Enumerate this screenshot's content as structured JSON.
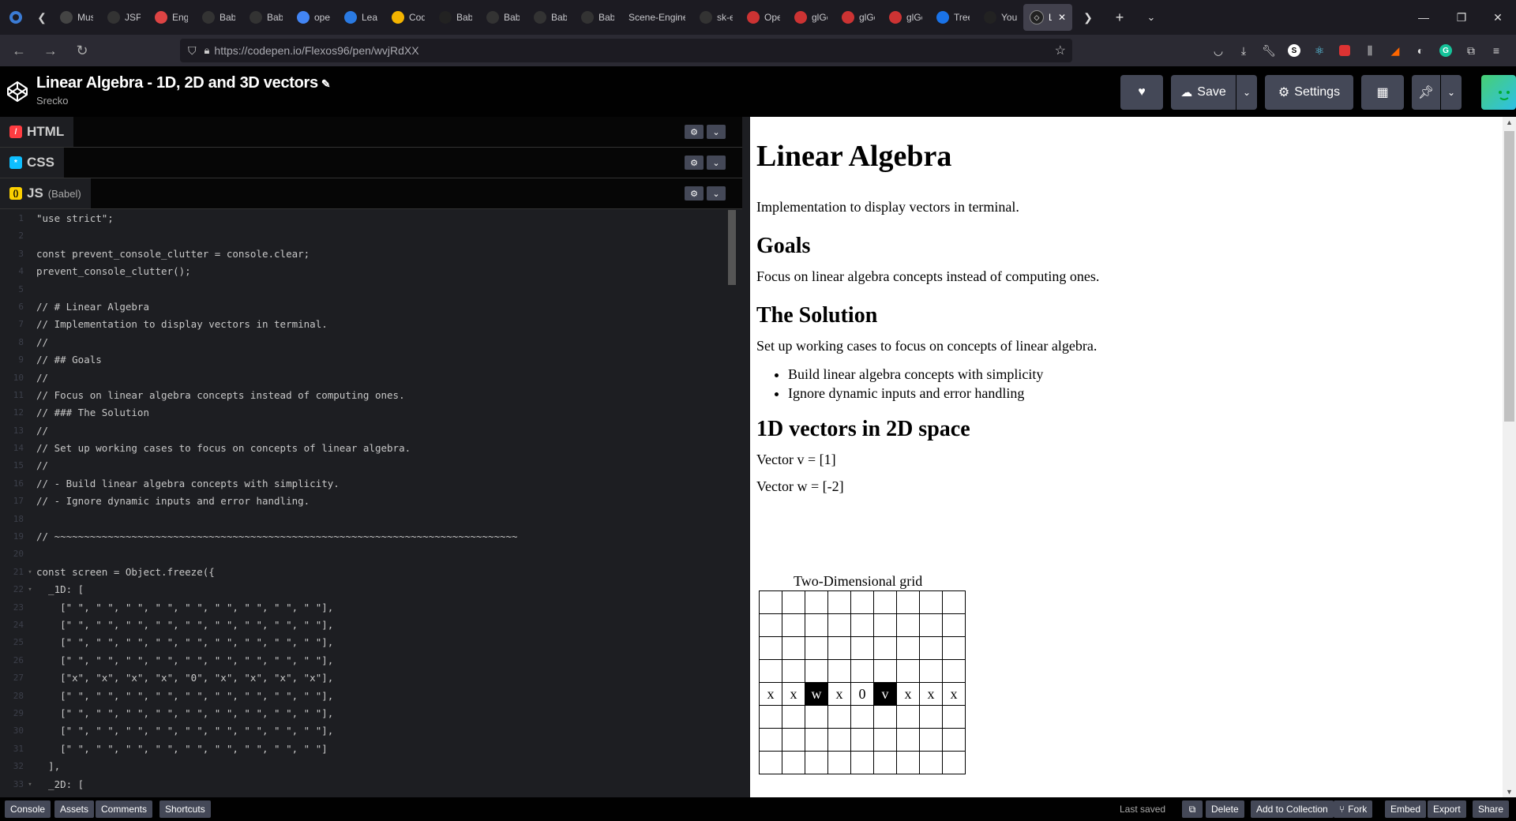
{
  "browser": {
    "tabs": [
      {
        "label": "Music",
        "icon": "music-icon",
        "color": "#444"
      },
      {
        "label": "JSProj",
        "icon": "github-icon",
        "color": "#333"
      },
      {
        "label": "Engine",
        "icon": "engine-icon",
        "color": "#d44"
      },
      {
        "label": "Babylon",
        "icon": "github-icon",
        "color": "#333"
      },
      {
        "label": "Babylon",
        "icon": "github-icon",
        "color": "#333"
      },
      {
        "label": "openg",
        "icon": "google-icon",
        "color": "#4285f4"
      },
      {
        "label": "Learn",
        "icon": "learn-icon",
        "color": "#2a7ae2"
      },
      {
        "label": "CodeP",
        "icon": "chart-icon",
        "color": "#f4b400"
      },
      {
        "label": "Babylon",
        "icon": "babylon-icon",
        "color": "#222"
      },
      {
        "label": "Babylon",
        "icon": "github-icon",
        "color": "#333"
      },
      {
        "label": "Babylon",
        "icon": "github-icon",
        "color": "#333"
      },
      {
        "label": "Babylon",
        "icon": "github-icon",
        "color": "#333"
      },
      {
        "label": "Scene-Engine",
        "icon": "none",
        "color": "#1c1b22"
      },
      {
        "label": "sk-eng",
        "icon": "github-icon",
        "color": "#333"
      },
      {
        "label": "OpenG",
        "icon": "opengl-icon",
        "color": "#c33"
      },
      {
        "label": "glGen",
        "icon": "opengl-icon",
        "color": "#c33"
      },
      {
        "label": "glGet",
        "icon": "opengl-icon",
        "color": "#c33"
      },
      {
        "label": "glGet",
        "icon": "opengl-icon",
        "color": "#c33"
      },
      {
        "label": "Tree G",
        "icon": "3d-icon",
        "color": "#1a73e8"
      },
      {
        "label": "Your W",
        "icon": "codepen-icon",
        "color": "#222"
      }
    ],
    "active_tab": "Linear",
    "url": "https://codepen.io/Flexos96/pen/wvjRdXX"
  },
  "pen": {
    "title": "Linear Algebra - 1D, 2D and 3D vectors",
    "author": "Srecko"
  },
  "header_buttons": {
    "save": "Save",
    "settings": "Settings"
  },
  "editors": {
    "html": "HTML",
    "css": "CSS",
    "js": "JS",
    "js_sub": "(Babel)"
  },
  "code_lines": [
    {
      "n": "1",
      "fold": "",
      "t": "\"use strict\";",
      "c": "str"
    },
    {
      "n": "2",
      "fold": "",
      "t": "",
      "c": ""
    },
    {
      "n": "3",
      "fold": "",
      "t": "const prevent_console_clutter = console.clear;",
      "c": "mix1"
    },
    {
      "n": "4",
      "fold": "",
      "t": "prevent_console_clutter();",
      "c": "def"
    },
    {
      "n": "5",
      "fold": "",
      "t": "",
      "c": ""
    },
    {
      "n": "6",
      "fold": "",
      "t": "// # Linear Algebra",
      "c": "com"
    },
    {
      "n": "7",
      "fold": "",
      "t": "// Implementation to display vectors in terminal.",
      "c": "com"
    },
    {
      "n": "8",
      "fold": "",
      "t": "//",
      "c": "com"
    },
    {
      "n": "9",
      "fold": "",
      "t": "// ## Goals",
      "c": "com"
    },
    {
      "n": "10",
      "fold": "",
      "t": "//",
      "c": "com"
    },
    {
      "n": "11",
      "fold": "",
      "t": "// Focus on linear algebra concepts instead of computing ones.",
      "c": "com"
    },
    {
      "n": "12",
      "fold": "",
      "t": "// ### The Solution",
      "c": "com"
    },
    {
      "n": "13",
      "fold": "",
      "t": "//",
      "c": "com"
    },
    {
      "n": "14",
      "fold": "",
      "t": "// Set up working cases to focus on concepts of linear algebra.",
      "c": "com"
    },
    {
      "n": "15",
      "fold": "",
      "t": "//",
      "c": "com"
    },
    {
      "n": "16",
      "fold": "",
      "t": "// - Build linear algebra concepts with simplicity.",
      "c": "com"
    },
    {
      "n": "17",
      "fold": "",
      "t": "// - Ignore dynamic inputs and error handling.",
      "c": "com"
    },
    {
      "n": "18",
      "fold": "",
      "t": "",
      "c": ""
    },
    {
      "n": "19",
      "fold": "",
      "t": "// ~~~~~~~~~~~~~~~~~~~~~~~~~~~~~~~~~~~~~~~~~~~~~~~~~~~~~~~~~~~~~~~~~~~~~~~~~~~~~~",
      "c": "com"
    },
    {
      "n": "20",
      "fold": "",
      "t": "",
      "c": ""
    },
    {
      "n": "21",
      "fold": "▾",
      "t": "const screen = Object.freeze({",
      "c": "mix2"
    },
    {
      "n": "22",
      "fold": "▾",
      "t": "  _1D: [",
      "c": "prop"
    },
    {
      "n": "23",
      "fold": "",
      "t": "    [\" \", \" \", \" \", \" \", \" \", \" \", \" \", \" \", \" \"],",
      "c": "str"
    },
    {
      "n": "24",
      "fold": "",
      "t": "    [\" \", \" \", \" \", \" \", \" \", \" \", \" \", \" \", \" \"],",
      "c": "str"
    },
    {
      "n": "25",
      "fold": "",
      "t": "    [\" \", \" \", \" \", \" \", \" \", \" \", \" \", \" \", \" \"],",
      "c": "str"
    },
    {
      "n": "26",
      "fold": "",
      "t": "    [\" \", \" \", \" \", \" \", \" \", \" \", \" \", \" \", \" \"],",
      "c": "str"
    },
    {
      "n": "27",
      "fold": "",
      "t": "    [\"x\", \"x\", \"x\", \"x\", \"0\", \"x\", \"x\", \"x\", \"x\"],",
      "c": "str"
    },
    {
      "n": "28",
      "fold": "",
      "t": "    [\" \", \" \", \" \", \" \", \" \", \" \", \" \", \" \", \" \"],",
      "c": "str"
    },
    {
      "n": "29",
      "fold": "",
      "t": "    [\" \", \" \", \" \", \" \", \" \", \" \", \" \", \" \", \" \"],",
      "c": "str"
    },
    {
      "n": "30",
      "fold": "",
      "t": "    [\" \", \" \", \" \", \" \", \" \", \" \", \" \", \" \", \" \"],",
      "c": "str"
    },
    {
      "n": "31",
      "fold": "",
      "t": "    [\" \", \" \", \" \", \" \", \" \", \" \", \" \", \" \", \" \"]",
      "c": "str"
    },
    {
      "n": "32",
      "fold": "",
      "t": "  ],",
      "c": ""
    },
    {
      "n": "33",
      "fold": "▾",
      "t": "  _2D: [",
      "c": "prop"
    }
  ],
  "preview": {
    "h1": "Linear Algebra",
    "intro": "Implementation to display vectors in terminal.",
    "goals_h": "Goals",
    "goals_p": "Focus on linear algebra concepts instead of computing ones.",
    "solution_h": "The Solution",
    "solution_p": "Set up working cases to focus on concepts of linear algebra.",
    "bullets": [
      "Build linear algebra concepts with simplicity",
      "Ignore dynamic inputs and error handling"
    ],
    "vec_h": "1D vectors in 2D space",
    "vec_v": "Vector v = [1]",
    "vec_w": "Vector w = [-2]",
    "grid_caption": "Two-Dimensional grid",
    "grid": [
      [
        " ",
        " ",
        " ",
        " ",
        " ",
        " ",
        " ",
        " ",
        " "
      ],
      [
        " ",
        " ",
        " ",
        " ",
        " ",
        " ",
        " ",
        " ",
        " "
      ],
      [
        " ",
        " ",
        " ",
        " ",
        " ",
        " ",
        " ",
        " ",
        " "
      ],
      [
        " ",
        " ",
        " ",
        " ",
        " ",
        " ",
        " ",
        " ",
        " "
      ],
      [
        "x",
        "x",
        "w",
        "x",
        "0",
        "v",
        "x",
        "x",
        "x"
      ],
      [
        " ",
        " ",
        " ",
        " ",
        " ",
        " ",
        " ",
        " ",
        " "
      ],
      [
        " ",
        " ",
        " ",
        " ",
        " ",
        " ",
        " ",
        " ",
        " "
      ],
      [
        " ",
        " ",
        " ",
        " ",
        " ",
        " ",
        " ",
        " ",
        " "
      ]
    ],
    "grid_highlight": [
      "w",
      "v"
    ]
  },
  "footer": {
    "left": [
      "Console",
      "Assets",
      "Comments",
      "Shortcuts"
    ],
    "last_saved": "Last saved",
    "right": [
      "Delete",
      "Add to Collection",
      "Fork",
      "Embed",
      "Export",
      "Share"
    ]
  },
  "colors": {
    "accent_green": "#47cf73",
    "html_red": "#ff3c41",
    "css_blue": "#0ebeff",
    "js_yellow": "#fcd000"
  }
}
